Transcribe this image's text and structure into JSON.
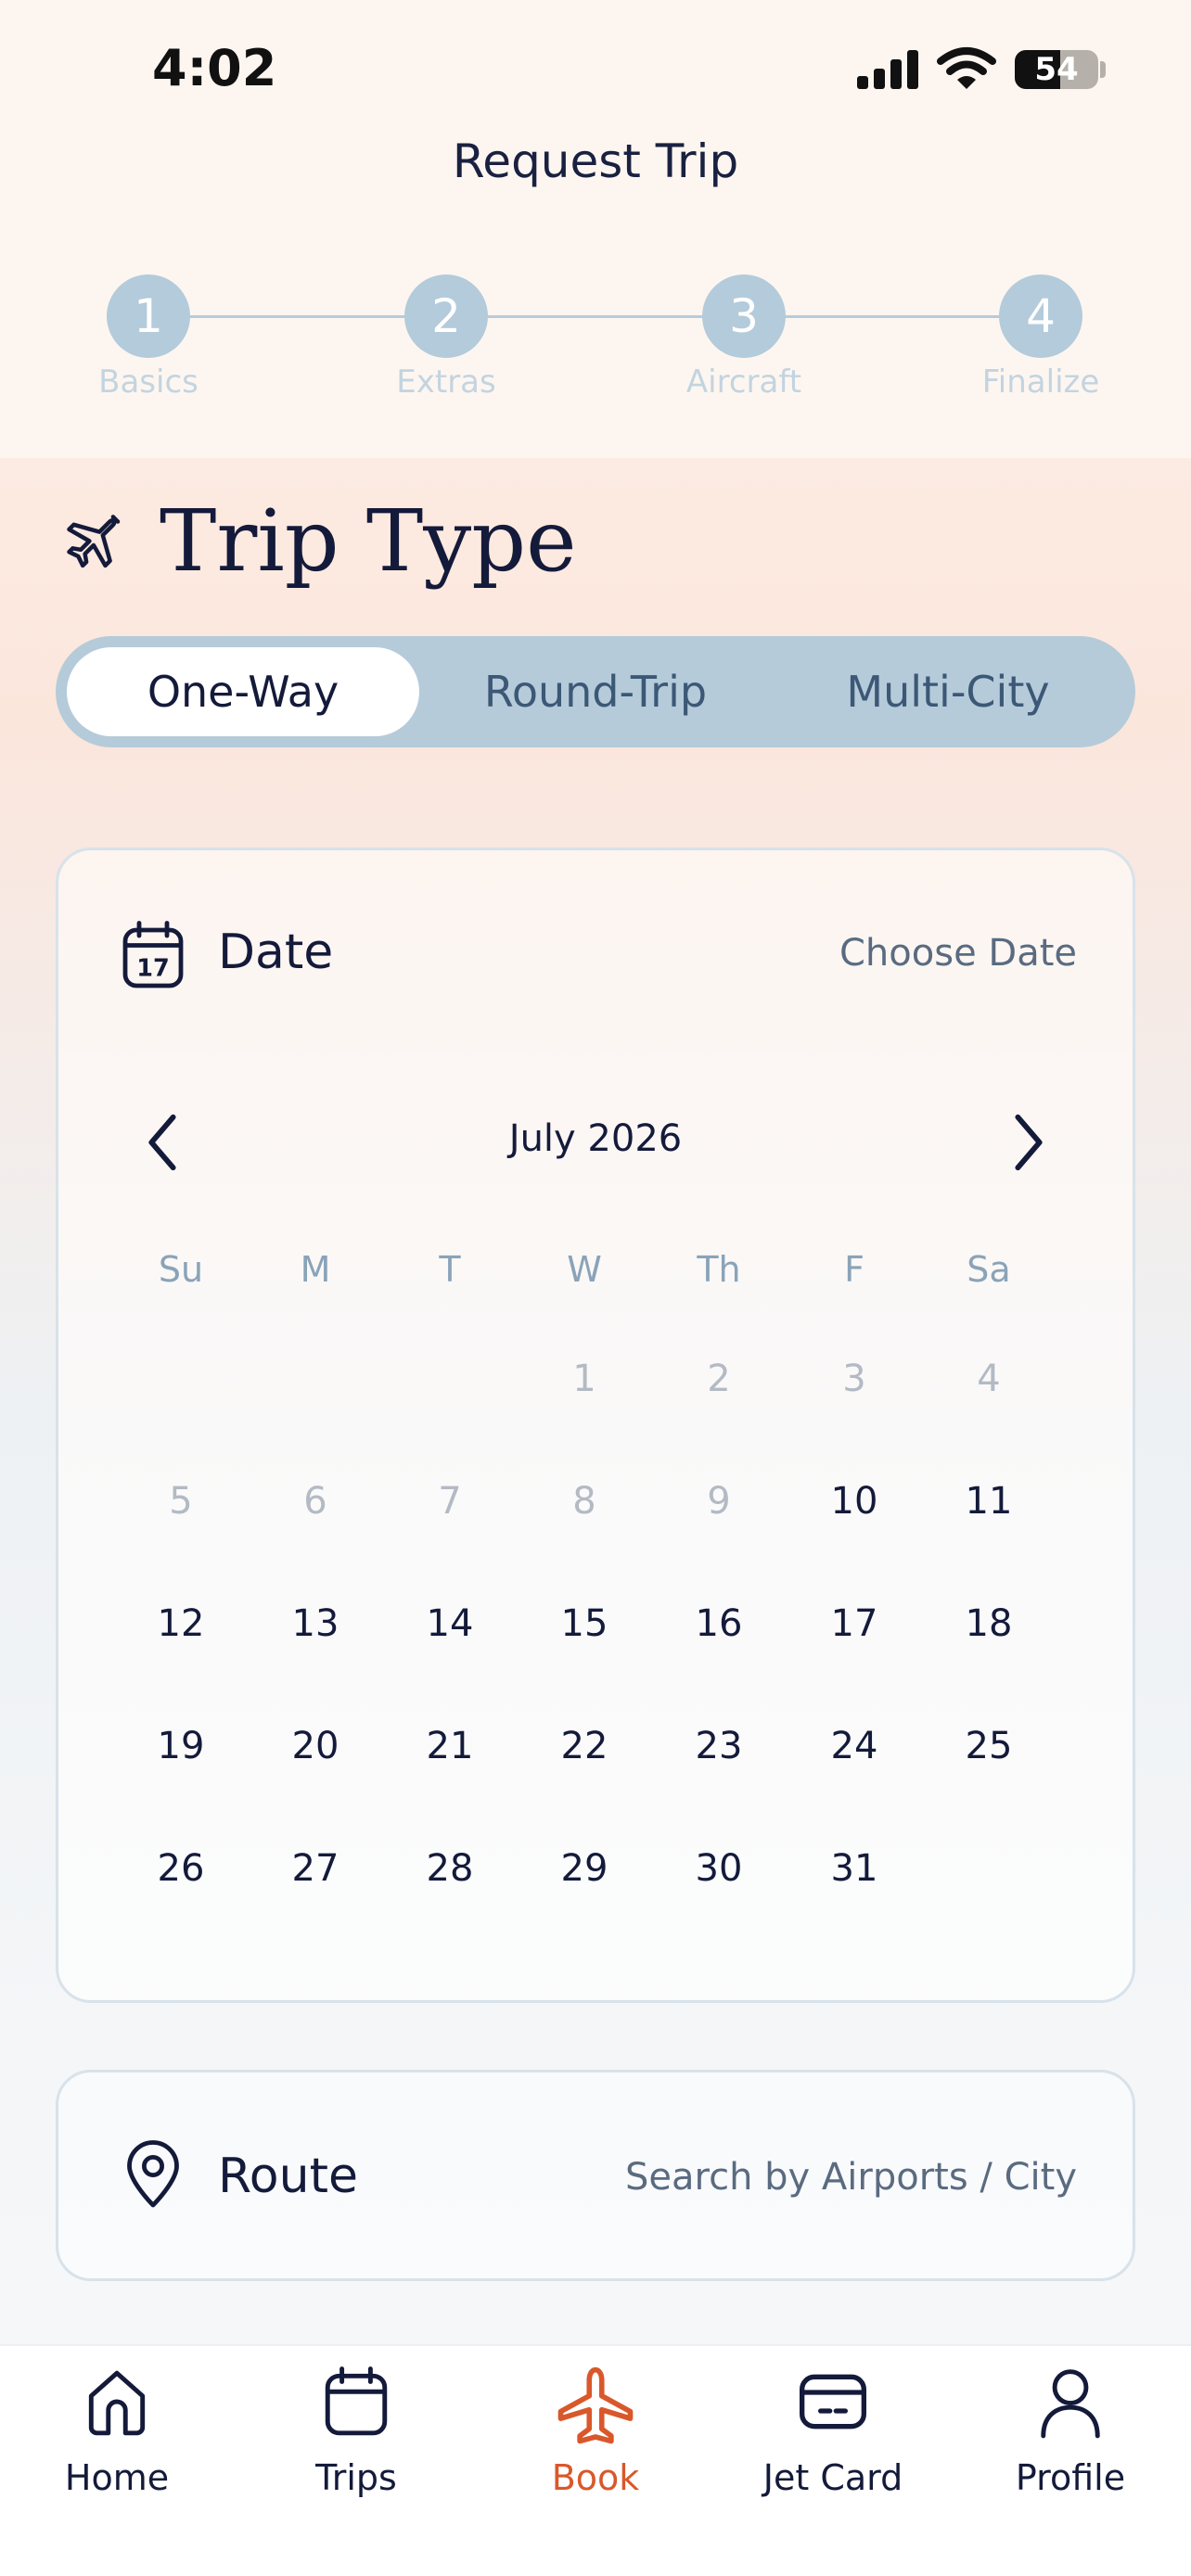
{
  "status_bar": {
    "time": "4:02",
    "battery": "54",
    "battery_level": 0.54
  },
  "header": {
    "title": "Request Trip"
  },
  "stepper": {
    "active_index": 0,
    "steps": [
      {
        "number": "1",
        "label": "Basics"
      },
      {
        "number": "2",
        "label": "Extras"
      },
      {
        "number": "3",
        "label": "Aircraft"
      },
      {
        "number": "4",
        "label": "Finalize"
      }
    ]
  },
  "trip_type": {
    "heading": "Trip Type",
    "icon": "plane-icon",
    "options": [
      "One-Way",
      "Round-Trip",
      "Multi-City"
    ],
    "selected_index": 0
  },
  "date": {
    "label": "Date",
    "icon": "calendar-icon",
    "calendar_icon_text": "17",
    "value_placeholder": "Choose Date",
    "month": "July 2026",
    "weekdays": [
      "Su",
      "M",
      "T",
      "W",
      "Th",
      "F",
      "Sa"
    ],
    "first_weekday_index": 3,
    "days_in_month": 31,
    "first_available_day": 10
  },
  "route": {
    "label": "Route",
    "icon": "location-pin-icon",
    "placeholder": "Search by Airports / City"
  },
  "tabbar": {
    "active_index": 2,
    "items": [
      {
        "label": "Home",
        "icon": "home-icon"
      },
      {
        "label": "Trips",
        "icon": "calendar-icon"
      },
      {
        "label": "Book",
        "icon": "plane-icon"
      },
      {
        "label": "Jet Card",
        "icon": "card-icon"
      },
      {
        "label": "Profile",
        "icon": "person-icon"
      }
    ]
  },
  "colors": {
    "accent": "#d9582b",
    "primary_dark": "#2e4f6e",
    "step_inactive": "#b3cbdb",
    "segmented_bg": "#b5cbda",
    "text_dark": "#141a3a"
  }
}
